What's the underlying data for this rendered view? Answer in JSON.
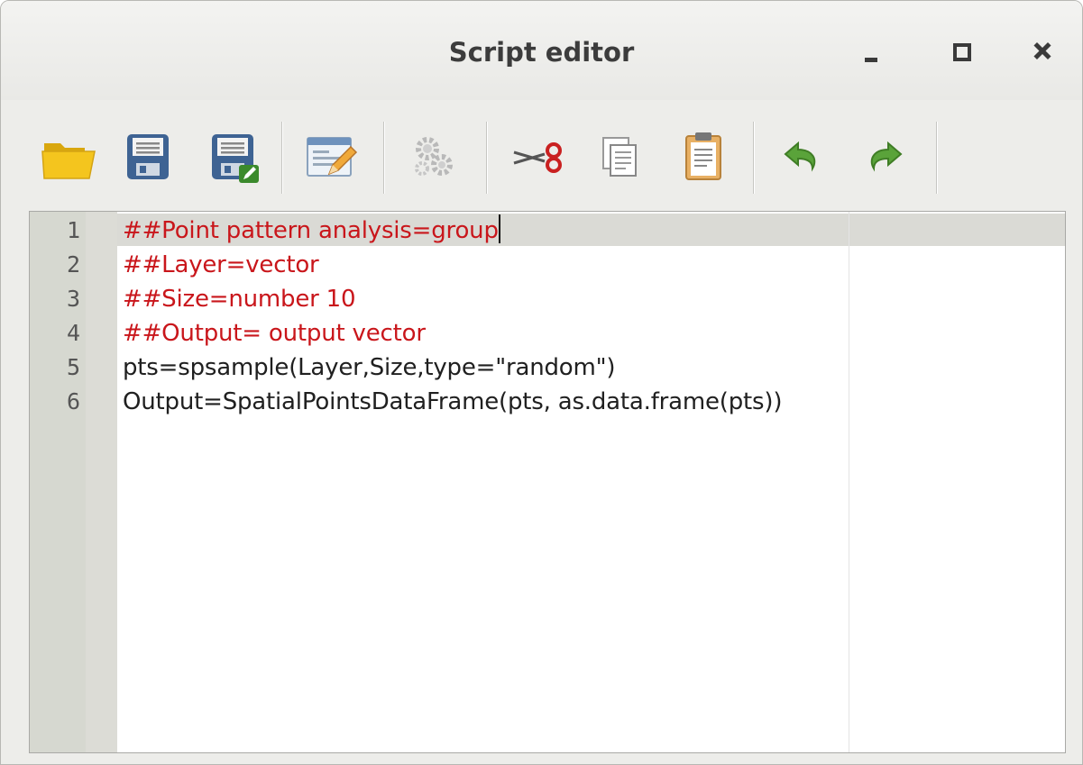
{
  "window": {
    "title": "Script editor",
    "controls": [
      "minimize",
      "maximize",
      "close"
    ]
  },
  "toolbar": {
    "buttons": [
      {
        "name": "open-script",
        "icon": "folder-open-icon"
      },
      {
        "name": "save-script",
        "icon": "floppy-disk-icon"
      },
      {
        "name": "save-as-script",
        "icon": "floppy-disk-edit-icon"
      },
      {
        "name": "edit-script-help",
        "icon": "form-edit-icon"
      },
      {
        "name": "run-algorithm",
        "icon": "gears-icon"
      },
      {
        "name": "cut",
        "icon": "scissors-icon"
      },
      {
        "name": "copy",
        "icon": "copy-icon"
      },
      {
        "name": "paste",
        "icon": "clipboard-icon"
      },
      {
        "name": "undo",
        "icon": "undo-arrow-icon"
      },
      {
        "name": "redo",
        "icon": "redo-arrow-icon"
      }
    ]
  },
  "editor": {
    "line_numbers": [
      "1",
      "2",
      "3",
      "4",
      "5",
      "6"
    ],
    "lines": [
      "##Point pattern analysis=group",
      "##Layer=vector",
      "##Size=number 10",
      "##Output= output vector",
      "pts=spsample(Layer,Size,type=\"random\")",
      "Output=SpatialPointsDataFrame(pts, as.data.frame(pts))"
    ],
    "colors": {
      "comment": "#c9161b",
      "code": "#202020",
      "current_line": "#dadad5"
    }
  }
}
